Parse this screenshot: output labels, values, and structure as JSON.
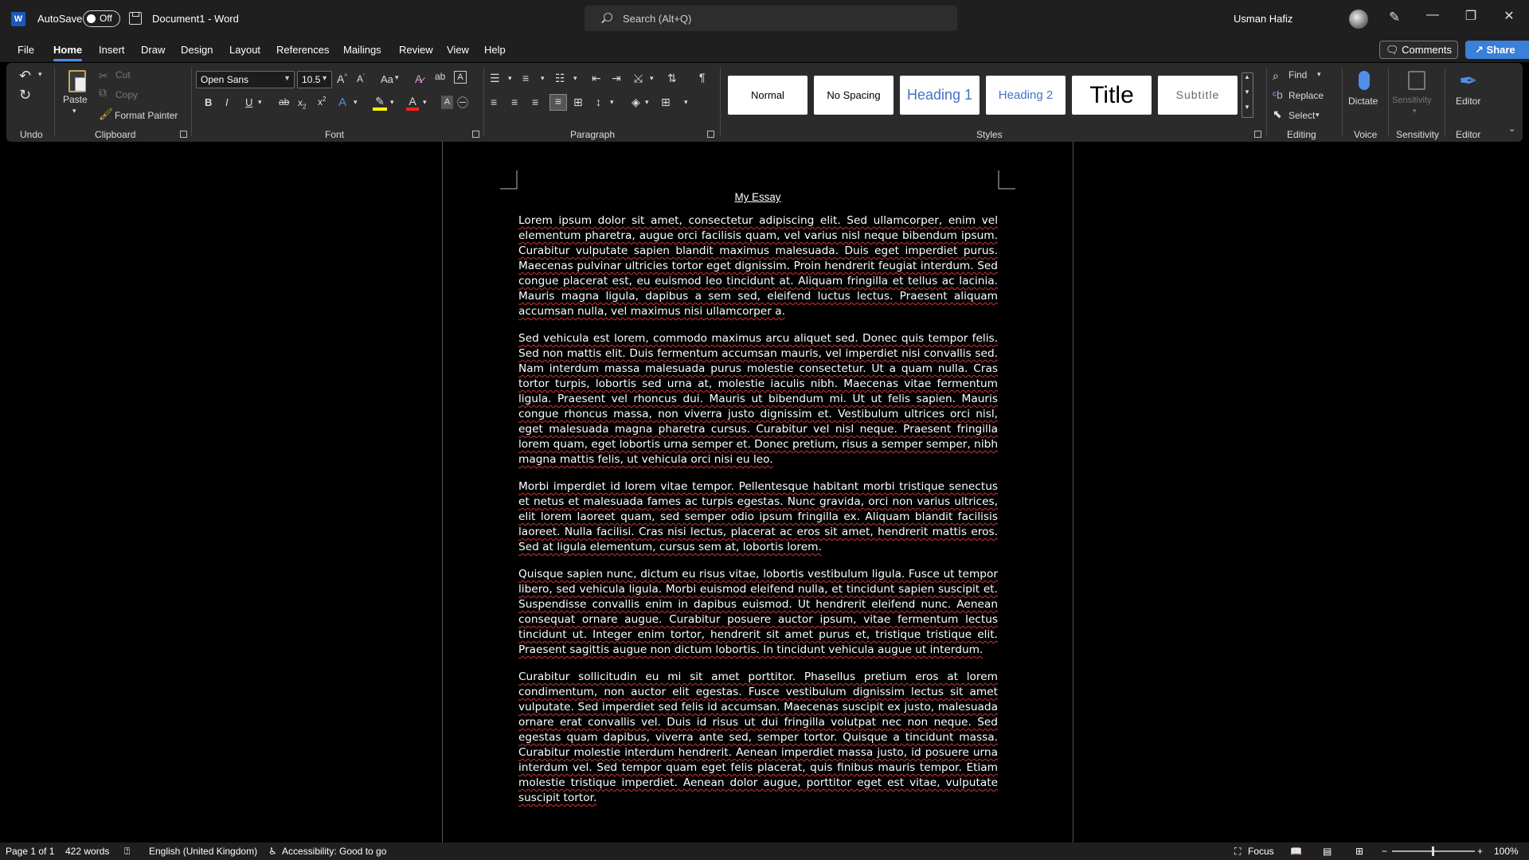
{
  "titlebar": {
    "app_icon": "word-logo-icon",
    "autosave_label": "AutoSave",
    "autosave_state": "Off",
    "document_title": "Document1  -  Word",
    "search_placeholder": "Search (Alt+Q)",
    "user_name": "Usman Hafiz",
    "window_controls": [
      "minimize-icon",
      "restore-icon",
      "close-icon"
    ]
  },
  "menu": {
    "tabs": [
      "File",
      "Home",
      "Insert",
      "Draw",
      "Design",
      "Layout",
      "References",
      "Mailings",
      "Review",
      "View",
      "Help"
    ],
    "active_tab": "Home",
    "comments_label": "Comments",
    "share_label": "Share"
  },
  "ribbon": {
    "undo": {
      "label": "Undo"
    },
    "clipboard": {
      "label": "Clipboard",
      "paste": "Paste",
      "cut": "Cut",
      "copy": "Copy",
      "format_painter": "Format Painter"
    },
    "font": {
      "label": "Font",
      "family": "Open Sans",
      "size": "10.5",
      "change_case": "Aa"
    },
    "paragraph": {
      "label": "Paragraph"
    },
    "styles": {
      "label": "Styles",
      "items": [
        "Normal",
        "No Spacing",
        "Heading 1",
        "Heading 2",
        "Title",
        "Subtitle"
      ]
    },
    "editing": {
      "label": "Editing",
      "find": "Find",
      "replace": "Replace",
      "select": "Select"
    },
    "voice": {
      "label": "Voice",
      "dictate": "Dictate"
    },
    "sensitivity": {
      "label": "Sensitivity",
      "button": "Sensitivity"
    },
    "editor": {
      "label": "Editor",
      "button": "Editor"
    }
  },
  "document": {
    "title": "My Essay",
    "paragraphs": [
      "Lorem ipsum dolor sit amet, consectetur adipiscing elit. Sed ullamcorper, enim vel elementum pharetra, augue orci facilisis quam, vel varius nisl neque bibendum ipsum. Curabitur vulputate sapien blandit maximus malesuada. Duis eget imperdiet purus. Maecenas pulvinar ultricies tortor eget dignissim. Proin hendrerit feugiat interdum. Sed congue placerat est, eu euismod leo tincidunt at. Aliquam fringilla et tellus ac lacinia. Mauris magna ligula, dapibus a sem sed, eleifend luctus lectus. Praesent aliquam accumsan nulla, vel maximus nisi ullamcorper a.",
      "Sed vehicula est lorem, commodo maximus arcu aliquet sed. Donec quis tempor felis. Sed non mattis elit. Duis fermentum accumsan mauris, vel imperdiet nisi convallis sed. Nam interdum massa malesuada purus molestie consectetur. Ut a quam nulla. Cras tortor turpis, lobortis sed urna at, molestie iaculis nibh. Maecenas vitae fermentum ligula. Praesent vel rhoncus dui. Mauris ut bibendum mi. Ut ut felis sapien. Mauris congue rhoncus massa, non viverra justo dignissim et. Vestibulum ultrices orci nisl, eget malesuada magna pharetra cursus. Curabitur vel nisl neque. Praesent fringilla lorem quam, eget lobortis urna semper et. Donec pretium, risus a semper semper, nibh magna mattis felis, ut vehicula orci nisi eu leo.",
      "Morbi imperdiet id lorem vitae tempor. Pellentesque habitant morbi tristique senectus et netus et malesuada fames ac turpis egestas. Nunc gravida, orci non varius ultrices, elit lorem laoreet quam, sed semper odio ipsum fringilla ex. Aliquam blandit facilisis laoreet. Nulla facilisi. Cras nisi lectus, placerat ac eros sit amet, hendrerit mattis eros. Sed at ligula elementum, cursus sem at, lobortis lorem.",
      "Quisque sapien nunc, dictum eu risus vitae, lobortis vestibulum ligula. Fusce ut tempor libero, sed vehicula ligula. Morbi euismod eleifend nulla, et tincidunt sapien suscipit et. Suspendisse convallis enim in dapibus euismod. Ut hendrerit eleifend nunc. Aenean consequat ornare augue. Curabitur posuere auctor ipsum, vitae fermentum lectus tincidunt ut. Integer enim tortor, hendrerit sit amet purus et, tristique tristique elit. Praesent sagittis augue non dictum lobortis. In tincidunt vehicula augue ut interdum.",
      "Curabitur sollicitudin eu mi sit amet porttitor. Phasellus pretium eros at lorem condimentum, non auctor elit egestas. Fusce vestibulum dignissim lectus sit amet vulputate. Sed imperdiet sed felis id accumsan. Maecenas suscipit ex justo, malesuada ornare erat convallis vel. Duis id risus ut dui fringilla volutpat nec non neque. Sed egestas quam dapibus, viverra ante sed, semper tortor. Quisque a tincidunt massa. Curabitur molestie interdum hendrerit. Aenean imperdiet massa justo, id posuere urna interdum vel. Sed tempor quam eget felis placerat, quis finibus mauris tempor. Etiam molestie tristique imperdiet. Aenean dolor augue, porttitor eget est vitae, vulputate suscipit tortor."
    ]
  },
  "statusbar": {
    "page": "Page 1 of 1",
    "words": "422 words",
    "language": "English (United Kingdom)",
    "accessibility": "Accessibility: Good to go",
    "focus": "Focus",
    "zoom": "100%"
  },
  "colors": {
    "accent_blue": "#185abd",
    "share_blue": "#3a7fd8",
    "spellcheck_red": "#d0342c",
    "heading_blue": "#4472c4"
  }
}
